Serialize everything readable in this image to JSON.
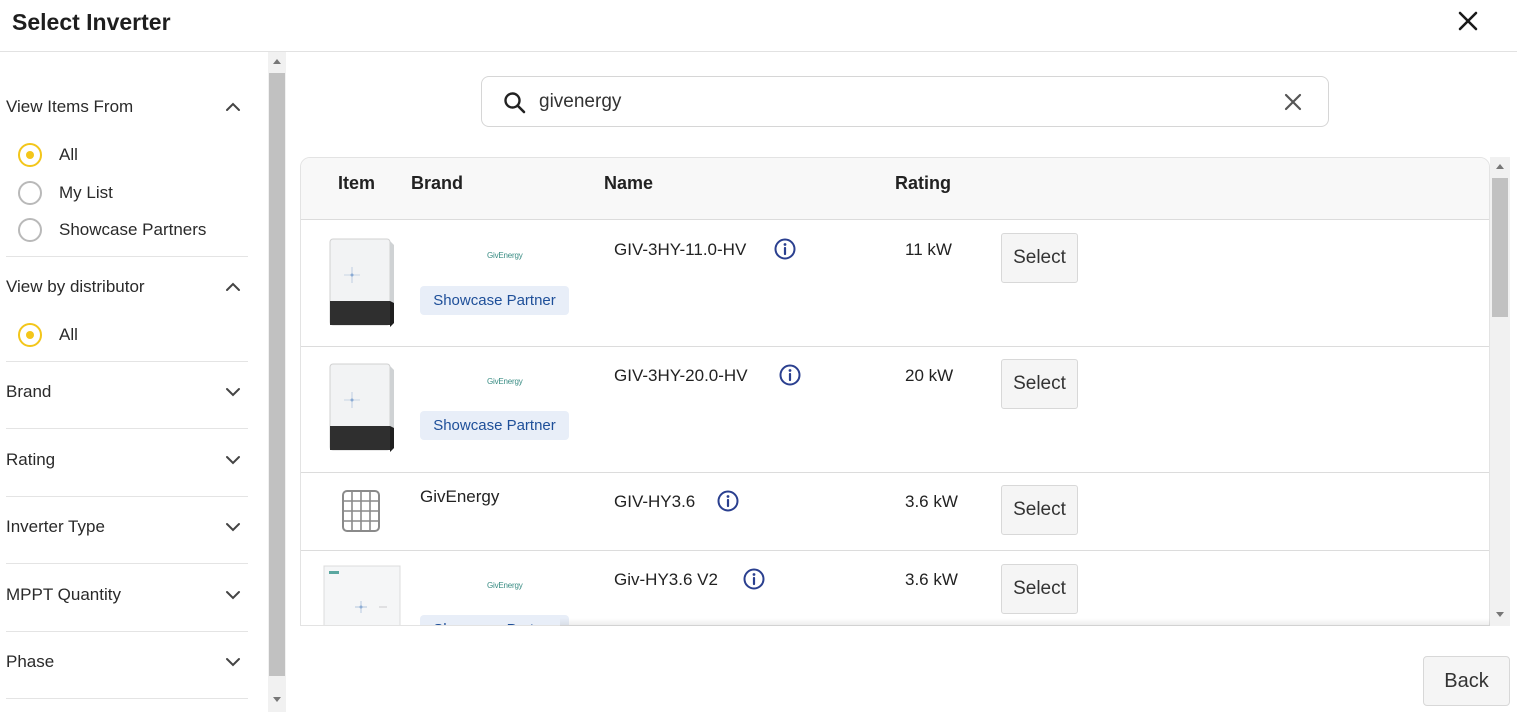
{
  "dialog": {
    "title": "Select Inverter"
  },
  "sidebar": {
    "view_items_from": {
      "heading": "View Items From",
      "options": [
        {
          "label": "All",
          "checked": true
        },
        {
          "label": "My List",
          "checked": false
        },
        {
          "label": "Showcase Partners",
          "checked": false
        }
      ]
    },
    "view_by_distributor": {
      "heading": "View by distributor",
      "options": [
        {
          "label": "All",
          "checked": true
        }
      ]
    },
    "filters": [
      "Brand",
      "Rating",
      "Inverter Type",
      "MPPT Quantity",
      "Phase"
    ]
  },
  "search": {
    "value": "givenergy",
    "placeholder": ""
  },
  "table": {
    "columns": [
      "Item",
      "Brand",
      "Name",
      "Rating"
    ],
    "rows": [
      {
        "brand_logo": "GivEnergy",
        "badge": "Showcase Partner",
        "name": "GIV-3HY-11.0-HV",
        "rating": "11 kW",
        "select": "Select"
      },
      {
        "brand_logo": "GivEnergy",
        "badge": "Showcase Partner",
        "name": "GIV-3HY-20.0-HV",
        "rating": "20 kW",
        "select": "Select"
      },
      {
        "brand_text": "GivEnergy",
        "name": "GIV-HY3.6",
        "rating": "3.6 kW",
        "select": "Select"
      },
      {
        "brand_logo": "GivEnergy",
        "badge": "Showcase Partner",
        "name": "Giv-HY3.6 V2",
        "rating": "3.6 kW",
        "select": "Select"
      }
    ]
  },
  "footer": {
    "back_label": "Back"
  },
  "colors": {
    "radio_accent": "#f3c61a",
    "badge_bg": "#e8eef8",
    "badge_text": "#1e4f99",
    "info_icon": "#2a3f8f"
  }
}
